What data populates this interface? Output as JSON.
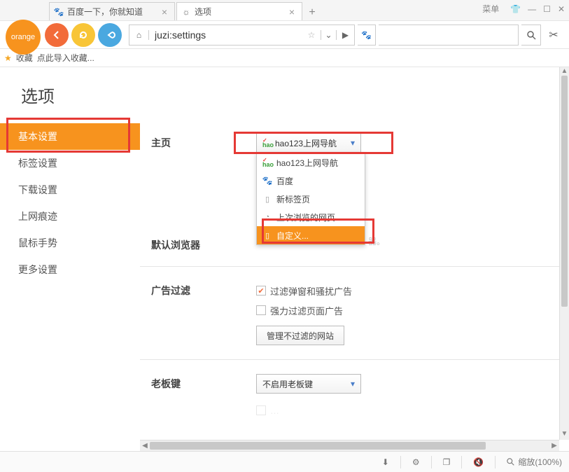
{
  "titlebar": {
    "tabs": [
      {
        "label": "百度一下，你就知道",
        "icon": "paw"
      },
      {
        "label": "选项",
        "icon": "gear"
      }
    ],
    "menu": "菜单"
  },
  "addr": {
    "url": "juzi:settings"
  },
  "bookmarks": {
    "fav": "收藏",
    "import": "点此导入收藏..."
  },
  "logo": "orange",
  "page": {
    "title": "选项"
  },
  "sidebar": {
    "items": [
      "基本设置",
      "标签设置",
      "下载设置",
      "上网痕迹",
      "鼠标手势",
      "更多设置"
    ],
    "active_index": 0
  },
  "sections": {
    "homepage": {
      "label": "主页",
      "selected": "hao123上网导航",
      "options": [
        "hao123上网导航",
        "百度",
        "新标签页",
        "上次浏览的网页",
        "自定义..."
      ]
    },
    "default_browser": {
      "label": "默认浏览器",
      "description_truncated": "器。"
    },
    "adblock": {
      "label": "广告过滤",
      "opt1": "过滤弹窗和骚扰广告",
      "opt1_checked": true,
      "opt2": "强力过滤页面广告",
      "opt2_checked": false,
      "manage_btn": "管理不过滤的网站"
    },
    "bosskey": {
      "label": "老板键",
      "selected": "不启用老板键"
    }
  },
  "status": {
    "zoom": "缩放(100%)"
  }
}
